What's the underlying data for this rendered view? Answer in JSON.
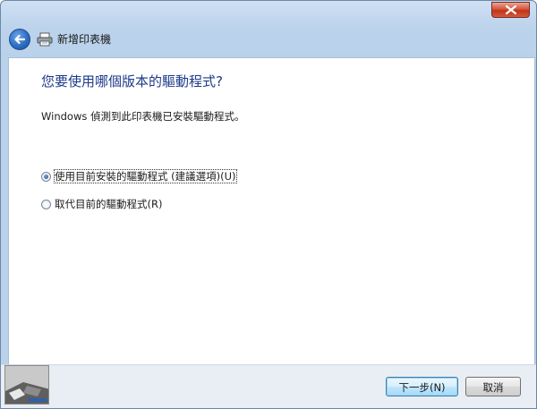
{
  "window": {
    "title": "新增印表機"
  },
  "page": {
    "heading": "您要使用哪個版本的驅動程式?",
    "description": "Windows 偵測到此印表機已安裝驅動程式。"
  },
  "options": [
    {
      "label": "使用目前安裝的驅動程式 (建議選項)(U)",
      "checked": true
    },
    {
      "label": "取代目前的驅動程式(R)",
      "checked": false
    }
  ],
  "buttons": {
    "next_label": "下一步(N)",
    "cancel_label": "取消"
  },
  "icons": {
    "close": "close-icon",
    "back": "back-arrow-icon",
    "printer": "printer-icon"
  },
  "colors": {
    "heading": "#1c3a8a",
    "close_button": "#c2321b",
    "back_button": "#2d6fc6"
  }
}
